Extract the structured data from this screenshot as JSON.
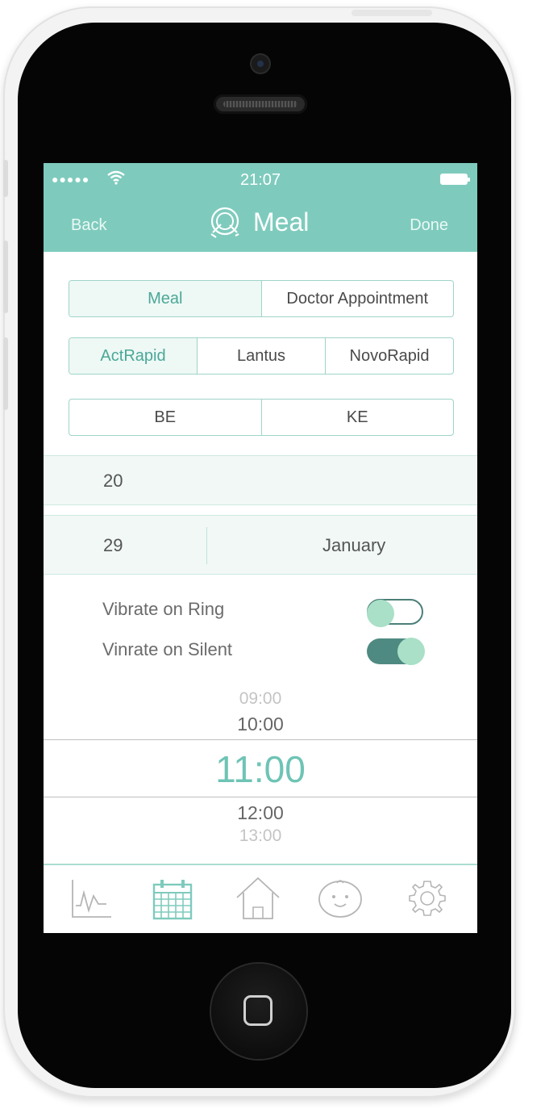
{
  "status_bar": {
    "signal": "●●●●●",
    "time": "21:07",
    "wifi_icon": "wifi-icon",
    "battery_icon": "battery-icon"
  },
  "nav": {
    "back_label": "Back",
    "title": "Meal",
    "done_label": "Done",
    "title_icon": "meal-plate-icon"
  },
  "segments": {
    "event_type": {
      "options": [
        "Meal",
        "Doctor Appointment"
      ],
      "selected": "Meal"
    },
    "insulin": {
      "options": [
        "ActRapid",
        "Lantus",
        "NovoRapid"
      ],
      "selected": "ActRapid"
    },
    "unit": {
      "options": [
        "BE",
        "KE"
      ],
      "selected": null
    }
  },
  "pickers": {
    "amount": "20",
    "day": "29",
    "month": "January"
  },
  "settings": {
    "vibrate_ring": {
      "label": "Vibrate on Ring",
      "on": false
    },
    "vibrate_silent": {
      "label": "Vinrate on Silent",
      "on": true
    }
  },
  "time_picker": {
    "values": [
      "09:00",
      "10:00",
      "11:00",
      "12:00",
      "13:00"
    ],
    "selected": "11:00"
  },
  "tabbar": {
    "items": [
      "stats-chart-icon",
      "calendar-icon",
      "home-icon",
      "baby-face-icon",
      "gear-icon"
    ],
    "active": "calendar-icon"
  },
  "colors": {
    "accent": "#7ecbbd",
    "accent_dark": "#4f8a82",
    "selected_text": "#4aa898"
  }
}
